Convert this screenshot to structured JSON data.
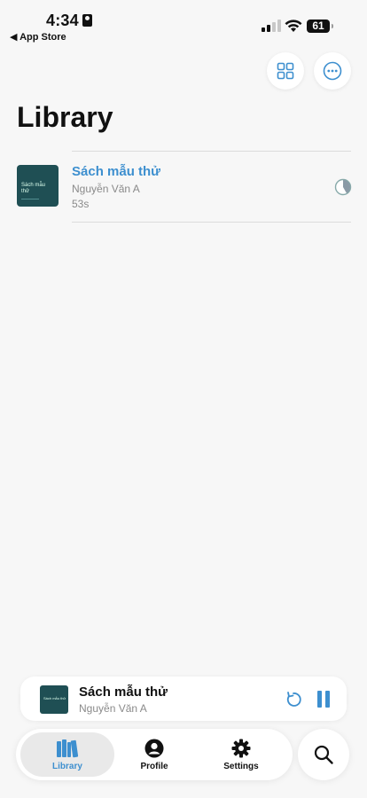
{
  "status_bar": {
    "time": "4:34",
    "back_label": "◀ App Store",
    "battery": "61"
  },
  "header": {
    "title": "Library",
    "grid_icon": "grid-icon",
    "more_icon": "ellipsis-circle-icon"
  },
  "books": [
    {
      "title": "Sách mẫu thử",
      "author": "Nguyễn Văn A",
      "duration": "53s",
      "progress_icon": "progress-pie-icon"
    }
  ],
  "mini_player": {
    "title": "Sách mẫu thử",
    "author": "Nguyễn Văn A",
    "replay_icon": "replay-icon",
    "pause_icon": "pause-icon"
  },
  "tabs": [
    {
      "label": "Library",
      "icon": "books-icon",
      "selected": true
    },
    {
      "label": "Profile",
      "icon": "person-circle-icon",
      "selected": false
    },
    {
      "label": "Settings",
      "icon": "gear-icon",
      "selected": false
    }
  ],
  "search_icon": "search-icon",
  "colors": {
    "accent": "#3d8fcf",
    "background": "#f7f7f7",
    "cover": "#1f4f54",
    "secondary_text": "#8a8a8a"
  }
}
